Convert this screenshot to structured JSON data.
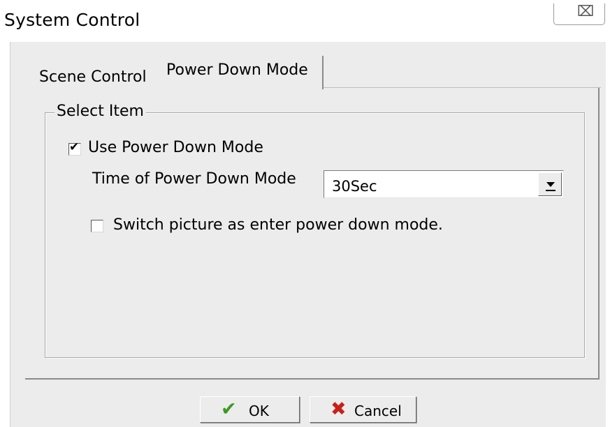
{
  "window": {
    "title": "System Control",
    "close_glyph": "⌧",
    "close_icon": "close-icon"
  },
  "tabs": [
    {
      "label": "Scene Control",
      "active": false
    },
    {
      "label": "Power Down Mode",
      "active": true
    }
  ],
  "group": {
    "legend": "Select Item",
    "use_power_down": {
      "label": "Use Power Down Mode",
      "checked": true,
      "check_glyph": "✔"
    },
    "time": {
      "label": "Time of Power Down Mode",
      "value": "30Sec"
    },
    "switch_picture": {
      "label": "Switch picture as enter power down mode.",
      "checked": false
    }
  },
  "buttons": {
    "ok": {
      "label": "OK",
      "icon": "checkmark-icon",
      "glyph": "✔",
      "icon_color": "#3c9a1e"
    },
    "cancel": {
      "label": "Cancel",
      "icon": "x-icon",
      "glyph": "✖",
      "icon_color": "#c8201a"
    }
  }
}
